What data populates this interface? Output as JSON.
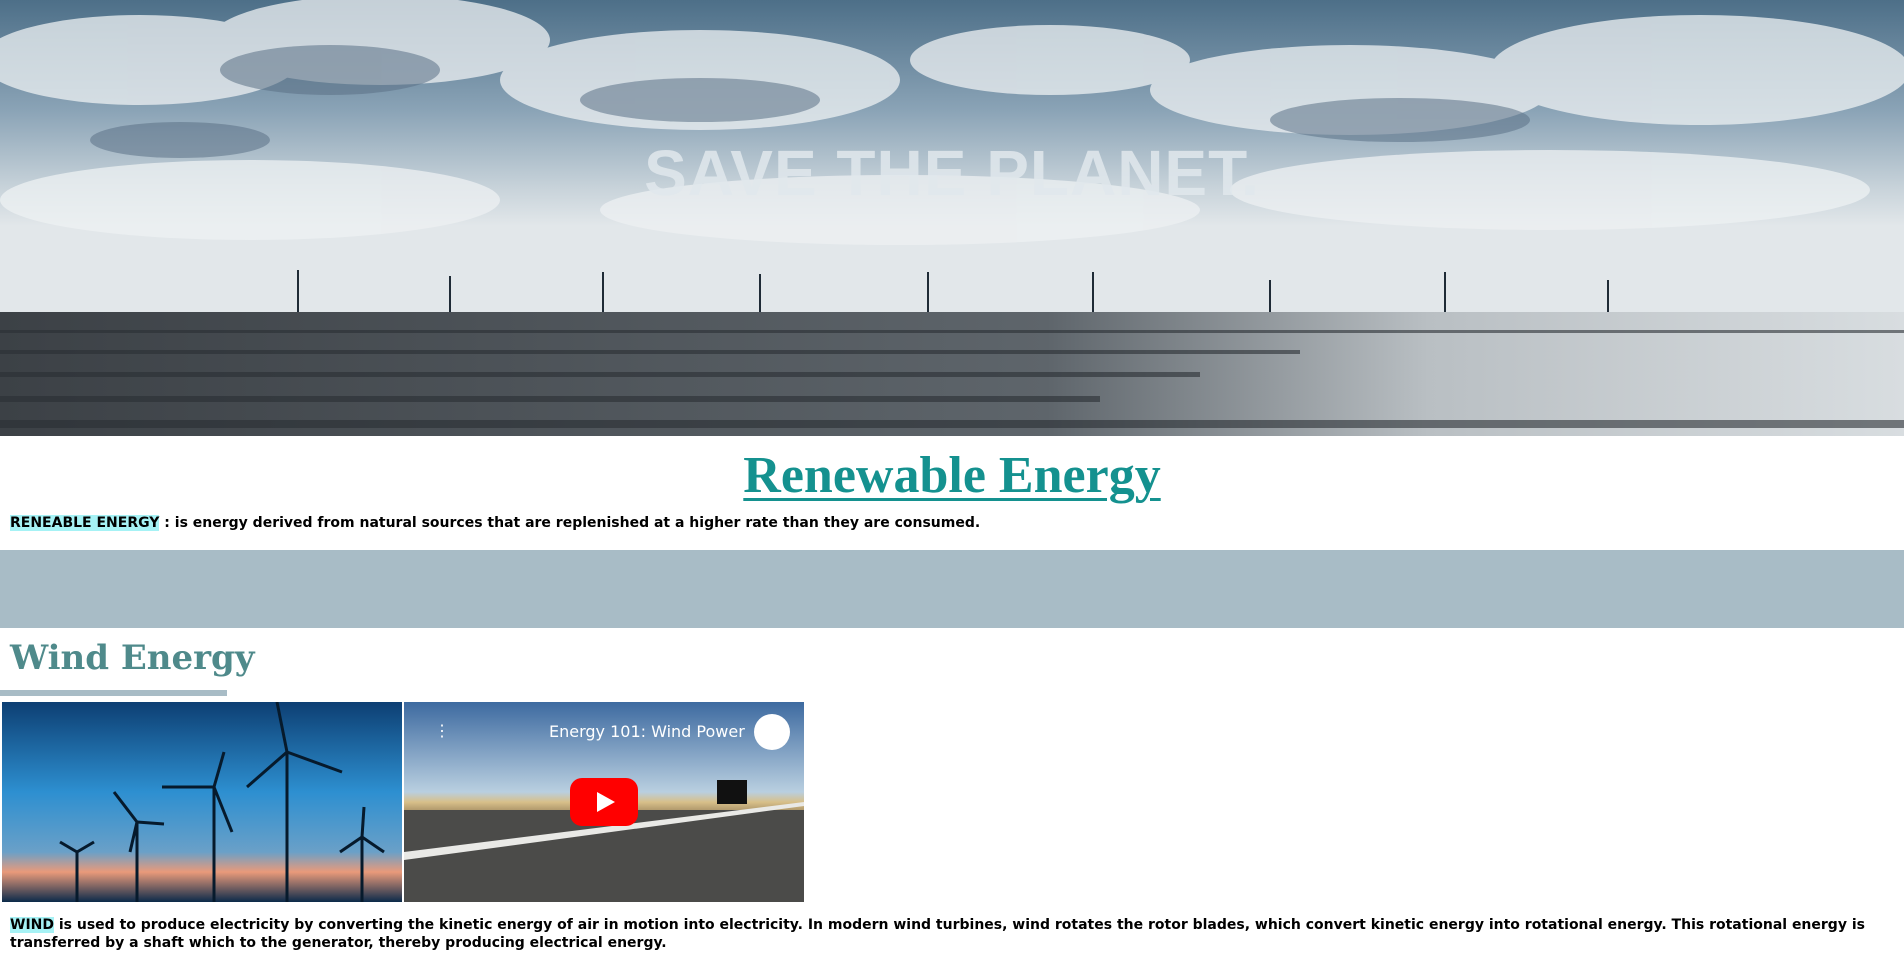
{
  "hero": {
    "title": "SAVE THE PLANET."
  },
  "page": {
    "title": "Renewable Energy"
  },
  "definition": {
    "term": "RENEABLE ENERGY",
    "text": " : is energy derived from natural sources that are replenished at a higher rate than they are consumed."
  },
  "wind": {
    "heading": "Wind Energy",
    "video_title": "Energy 101: Wind Power",
    "term": "WIND",
    "text": " is used to produce electricity by converting the kinetic energy of air in motion into electricity. In modern wind turbines, wind rotates the rotor blades, which convert kinetic energy into rotational energy. This rotational energy is transferred by a shaft which to the generator, thereby producing electrical energy."
  },
  "colors": {
    "title_teal": "#14918f",
    "heading_teal": "#4f8a8b",
    "highlight": "#a6f2f5",
    "band": "#a8bcc6",
    "play_red": "#ff0000"
  },
  "icons": {
    "video_menu": "more-vert-icon",
    "channel": "energy-channel-logo",
    "play": "youtube-play-icon"
  }
}
